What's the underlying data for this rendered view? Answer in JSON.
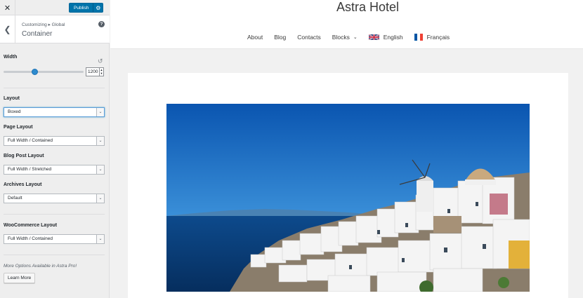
{
  "topbar": {
    "close_glyph": "✕",
    "publish_label": "Publish",
    "gear_glyph": "⚙"
  },
  "section": {
    "back_glyph": "❮",
    "breadcrumb": "Customizing ▸ Global",
    "title": "Container",
    "help_glyph": "?"
  },
  "controls": {
    "width": {
      "label": "Width",
      "value": "1200",
      "slider_fraction": 0.39,
      "reset_glyph": "↺"
    },
    "layout": {
      "label": "Layout",
      "value": "Boxed"
    },
    "page_layout": {
      "label": "Page Layout",
      "value": "Full Width / Contained"
    },
    "blog_post_layout": {
      "label": "Blog Post Layout",
      "value": "Full Width / Stretched"
    },
    "archives_layout": {
      "label": "Archives Layout",
      "value": "Default"
    },
    "woocommerce_layout": {
      "label": "WooCommerce Layout",
      "value": "Full Width / Contained"
    },
    "select_caret": "⌄"
  },
  "promo": {
    "text": "More Options Available in Astra Pro!",
    "button_label": "Learn More"
  },
  "site": {
    "title": "Astra Hotel",
    "nav": [
      {
        "label": "About"
      },
      {
        "label": "Blog"
      },
      {
        "label": "Contacts"
      },
      {
        "label": "Blocks",
        "chevron": "⌄"
      },
      {
        "label": "English",
        "flag": "uk"
      },
      {
        "label": "Français",
        "flag": "fr"
      }
    ]
  },
  "colors": {
    "accent": "#0073aa",
    "slider": "#2e8bce",
    "sky": "#0a5fb8",
    "sea": "#0b3d78"
  },
  "icons": {
    "close": "close-icon",
    "settings": "gear-icon",
    "back": "chevron-left-icon",
    "help": "help-icon",
    "reset": "reset-icon",
    "dropdown": "chevron-down-icon"
  }
}
